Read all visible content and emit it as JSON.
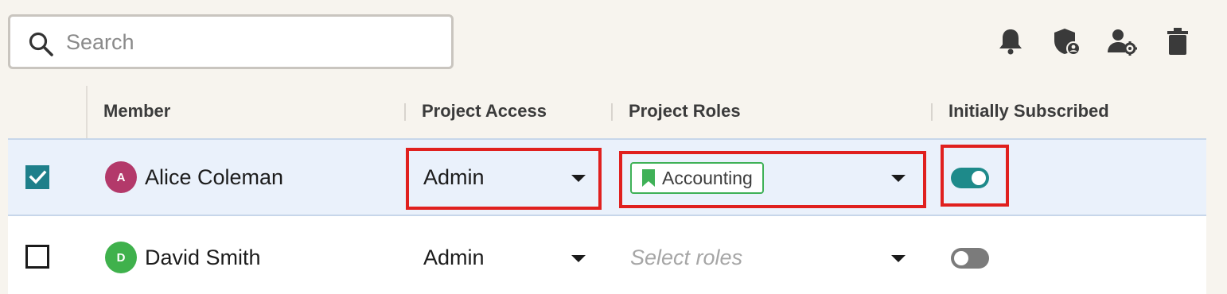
{
  "search": {
    "placeholder": "Search"
  },
  "toolbar": {
    "icons": [
      "bell-icon",
      "shield-user-icon",
      "user-settings-icon",
      "trash-icon"
    ]
  },
  "table": {
    "headers": {
      "member": "Member",
      "access": "Project Access",
      "roles": "Project Roles",
      "subscribed": "Initially Subscribed"
    },
    "rows": [
      {
        "selected": true,
        "avatar_initial": "A",
        "avatar_color": "#b3396a",
        "name": "Alice Coleman",
        "access": "Admin",
        "roles": [
          "Accounting"
        ],
        "roles_placeholder": "Select roles",
        "subscribed": true
      },
      {
        "selected": false,
        "avatar_initial": "D",
        "avatar_color": "#3fb14c",
        "name": "David Smith",
        "access": "Admin",
        "roles": [],
        "roles_placeholder": "Select roles",
        "subscribed": false
      }
    ]
  },
  "colors": {
    "background": "#f7f4ee",
    "selected_row": "#eaf1fb",
    "accent_teal": "#1e8a8a",
    "tag_green": "#3fb157",
    "highlight_red": "#e0201e"
  }
}
